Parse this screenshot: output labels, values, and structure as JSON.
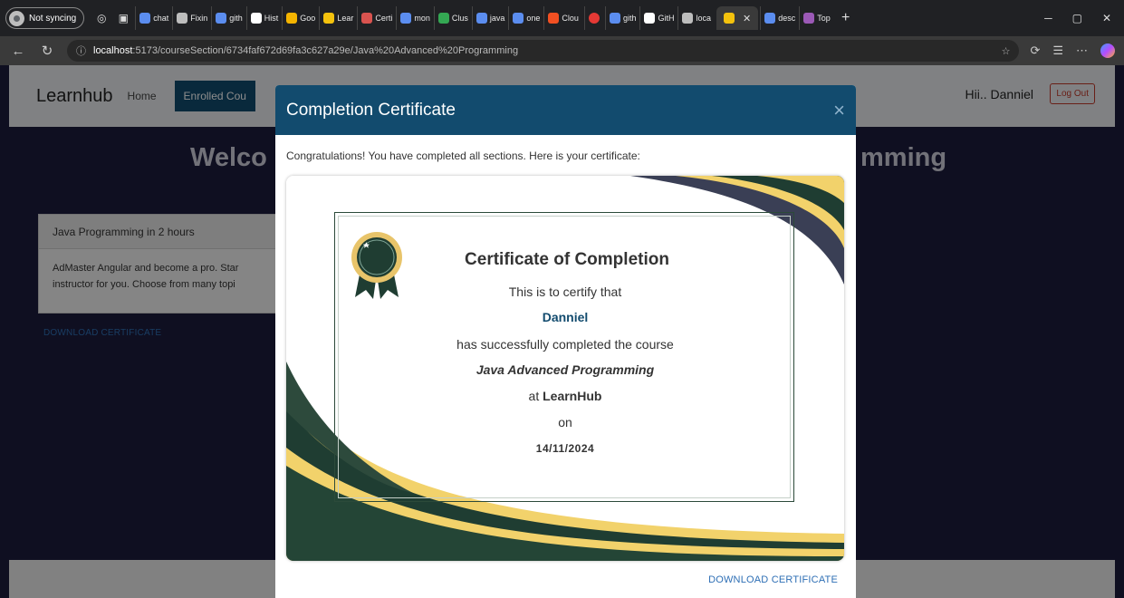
{
  "browser": {
    "profile_label": "Not syncing",
    "tabs": [
      {
        "label": "chat",
        "color": "#5b8def"
      },
      {
        "label": "Fixin",
        "color": "#bdbdbd"
      },
      {
        "label": "gith",
        "color": "#5b8def"
      },
      {
        "label": "Hist",
        "color": "#ffffff"
      },
      {
        "label": "Goo",
        "color": "#f4b400"
      },
      {
        "label": "Lear",
        "color": "#f4c20d"
      },
      {
        "label": "Certi",
        "color": "#d9534f"
      },
      {
        "label": "mon",
        "color": "#5b8def"
      },
      {
        "label": "Clus",
        "color": "#34a853"
      },
      {
        "label": "java",
        "color": "#5b8def"
      },
      {
        "label": "one",
        "color": "#5b8def"
      },
      {
        "label": "Clou",
        "color": "#f25022"
      }
    ],
    "tabs_right": [
      {
        "label": "gith",
        "color": "#5b8def"
      },
      {
        "label": "GitH",
        "color": "#ffffff"
      },
      {
        "label": "loca",
        "color": "#bdbdbd"
      }
    ],
    "tabs_after": [
      {
        "label": "desc",
        "color": "#5b8def"
      },
      {
        "label": "Top",
        "color": "#9b59b6"
      }
    ],
    "url_host": "localhost",
    "url_path": ":5173/courseSection/6734faf672d69fa3c627a29e/Java%20Advanced%20Programming"
  },
  "navbar": {
    "brand": "Learnhub",
    "home": "Home",
    "enrolled": "Enrolled Cou",
    "greeting": "Hii.. Danniel",
    "logout": "Log Out"
  },
  "background": {
    "welcome_left": "Welco",
    "welcome_right": "mming",
    "card_title": "Java Programming in 2 hours",
    "card_body_1": "AdMaster Angular and become a pro. Star",
    "card_body_2": "instructor for you. Choose from many topi",
    "download": "DOWNLOAD CERTIFICATE"
  },
  "modal": {
    "title": "Completion Certificate",
    "close": "×",
    "congrats": "Congratulations! You have completed all sections. Here is your certificate:",
    "download": "DOWNLOAD CERTIFICATE"
  },
  "certificate": {
    "heading": "Certificate of Completion",
    "certify": "This is to certify that",
    "name": "Danniel",
    "completed": "has successfully completed the course",
    "course": "Java Advanced Programming",
    "at": "at",
    "org": "LearnHub",
    "on": "on",
    "date": "14/11/2024"
  },
  "colors": {
    "brand_blue": "#124b6e",
    "link_blue": "#2e6fb5",
    "cert_green": "#1f3d32",
    "cert_gold": "#f2d26b"
  }
}
